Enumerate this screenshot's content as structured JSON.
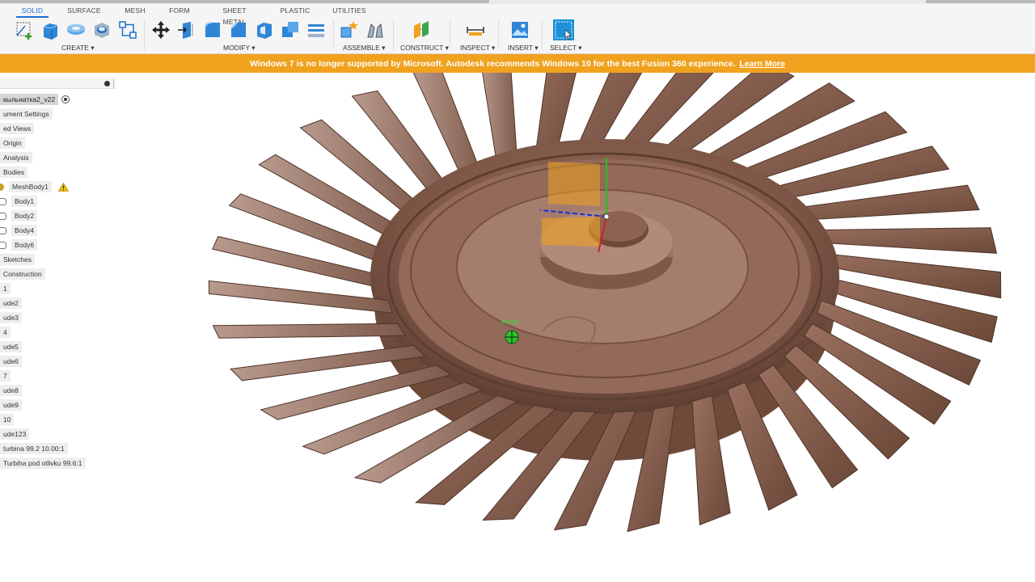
{
  "ribbon": {
    "tabs": [
      "SOLID",
      "SURFACE",
      "MESH",
      "FORM",
      "SHEET METAL",
      "PLASTIC",
      "UTILITIES"
    ],
    "active_tab": "SOLID",
    "groups": {
      "create": "CREATE ▾",
      "modify": "MODIFY ▾",
      "assemble": "ASSEMBLE ▾",
      "construct": "CONSTRUCT ▾",
      "inspect": "INSPECT ▾",
      "insert": "INSERT ▾",
      "select": "SELECT ▾"
    }
  },
  "banner": {
    "message": "Windows 7 is no longer supported by Microsoft. Autodesk recommends Windows 10 for the best Fusion 360 experience.",
    "link": "Learn More",
    "color": "#f0a21f"
  },
  "browser": {
    "document": "кыльнатка2_v22",
    "items": [
      "ument Settings",
      "ed Views",
      "Origin",
      "Analysis",
      "Bodies",
      "MeshBody1",
      "Body1",
      "Body2",
      "Body4",
      "Body6",
      "Sketches",
      "Construction",
      "1",
      "ude2",
      "ude3",
      "4",
      "ude5",
      "ude6",
      "7",
      "ude8",
      "ude9",
      "10",
      "ude123",
      "turbina 99.2 10.00:1",
      "Turbiha pod otlivku 99.6:1"
    ]
  },
  "viewport": {
    "pivot_label": "PIVOT",
    "model_color": "#8a5f4e"
  }
}
